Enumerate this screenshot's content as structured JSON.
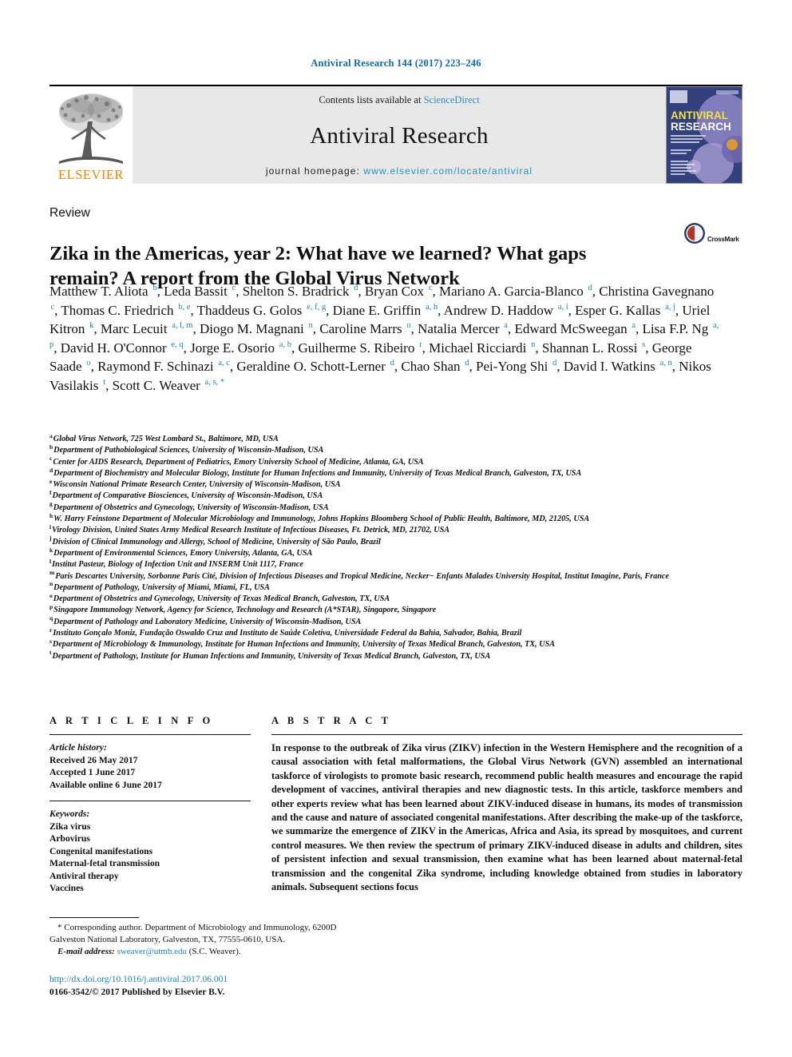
{
  "running_head": "Antiviral Research 144 (2017) 223–246",
  "masthead": {
    "publisher_name": "ELSEVIER",
    "contents_prefix": "Contents lists available at",
    "contents_link": "ScienceDirect",
    "journal_title": "Antiviral Research",
    "homepage_prefix": "journal homepage:",
    "homepage_url": "www.elsevier.com/locate/antiviral",
    "cover_title_line1": "ANTIVIRAL",
    "cover_title_line2": "RESEARCH"
  },
  "article_type": "Review",
  "title": "Zika in the Americas, year 2: What have we learned? What gaps remain? A report from the Global Virus Network",
  "crossmark": {
    "label": "CrossMark"
  },
  "authors_html": "Matthew T. Aliota <sup>b</sup>, Leda Bassit <sup>c</sup>, Shelton S. Bradrick <sup>d</sup>, Bryan Cox <sup>c</sup>, Mariano A. Garcia-Blanco <sup>d</sup>, Christina Gavegnano <sup>c</sup>, Thomas C. Friedrich <sup>b, e</sup>, Thaddeus G. Golos <sup>e, f, g</sup>, Diane E. Griffin <sup>a, h</sup>, Andrew D. Haddow <sup>a, i</sup>, Esper G. Kallas <sup>a, j</sup>, Uriel Kitron <sup>k</sup>, Marc Lecuit <sup>a, l, m</sup>, Diogo M. Magnani <sup>n</sup>, Caroline Marrs <sup>o</sup>, Natalia Mercer <sup>a</sup>, Edward McSweegan <sup>a</sup>, Lisa F.P. Ng <sup>a, p</sup>, David H. O'Connor <sup>e, q</sup>, Jorge E. Osorio <sup>a, b</sup>, Guilherme S. Ribeiro <sup>r</sup>, Michael Ricciardi <sup>n</sup>, Shannan L. Rossi <sup>s</sup>, George Saade <sup>o</sup>, Raymond F. Schinazi <sup>a, c</sup>, Geraldine O. Schott-Lerner <sup>d</sup>, Chao Shan <sup>d</sup>, Pei-Yong Shi <sup>d</sup>, David I. Watkins <sup>a, n</sup>, Nikos Vasilakis <sup>t</sup>, Scott C. Weaver <sup>a, s, *</sup>",
  "affiliations": [
    {
      "marker": "a",
      "text": "Global Virus Network, 725 West Lombard St., Baltimore, MD, USA"
    },
    {
      "marker": "b",
      "text": "Department of Pathobiological Sciences, University of Wisconsin-Madison, USA"
    },
    {
      "marker": "c",
      "text": "Center for AIDS Research, Department of Pediatrics, Emory University School of Medicine, Atlanta, GA, USA"
    },
    {
      "marker": "d",
      "text": "Department of Biochemistry and Molecular Biology, Institute for Human Infections and Immunity, University of Texas Medical Branch, Galveston, TX, USA"
    },
    {
      "marker": "e",
      "text": "Wisconsin National Primate Research Center, University of Wisconsin-Madison, USA"
    },
    {
      "marker": "f",
      "text": "Department of Comparative Biosciences, University of Wisconsin-Madison, USA"
    },
    {
      "marker": "g",
      "text": "Department of Obstetrics and Gynecology, University of Wisconsin-Madison, USA"
    },
    {
      "marker": "h",
      "text": "W. Harry Feinstone Department of Molecular Microbiology and Immunology, Johns Hopkins Bloomberg School of Public Health, Baltimore, MD, 21205, USA"
    },
    {
      "marker": "i",
      "text": "Virology Division, United States Army Medical Research Institute of Infectious Diseases, Ft. Detrick, MD, 21702, USA"
    },
    {
      "marker": "j",
      "text": "Division of Clinical Immunology and Allergy, School of Medicine, University of São Paulo, Brazil"
    },
    {
      "marker": "k",
      "text": "Department of Environmental Sciences, Emory University, Atlanta, GA, USA"
    },
    {
      "marker": "l",
      "text": "Institut Pasteur, Biology of Infection Unit and INSERM Unit 1117, France"
    },
    {
      "marker": "m",
      "text": "Paris Descartes University, Sorbonne Paris Cité, Division of Infectious Diseases and Tropical Medicine, Necker− Enfants Malades University Hospital, Institut Imagine, Paris, France"
    },
    {
      "marker": "n",
      "text": "Department of Pathology, University of Miami, Miami, FL, USA"
    },
    {
      "marker": "o",
      "text": "Department of Obstetrics and Gynecology, University of Texas Medical Branch, Galveston, TX, USA"
    },
    {
      "marker": "p",
      "text": "Singapore Immunology Network, Agency for Science, Technology and Research (A*STAR), Singapore, Singapore"
    },
    {
      "marker": "q",
      "text": "Department of Pathology and Laboratory Medicine, University of Wisconsin-Madison, USA"
    },
    {
      "marker": "r",
      "text": "Instituto Gonçalo Moniz, Fundação Oswaldo Cruz and Instituto de Saúde Coletiva, Universidade Federal da Bahia, Salvador, Bahia, Brazil"
    },
    {
      "marker": "s",
      "text": "Department of Microbiology & Immunology, Institute for Human Infections and Immunity, University of Texas Medical Branch, Galveston, TX, USA"
    },
    {
      "marker": "t",
      "text": "Department of Pathology, Institute for Human Infections and Immunity, University of Texas Medical Branch, Galveston, TX, USA"
    }
  ],
  "article_info": {
    "heading": "A R T I C L E   I N F O",
    "history_label": "Article history:",
    "history": [
      "Received 26 May 2017",
      "Accepted 1 June 2017",
      "Available online 6 June 2017"
    ],
    "keywords_label": "Keywords:",
    "keywords": [
      "Zika virus",
      "Arbovirus",
      "Congenital manifestations",
      "Maternal-fetal transmission",
      "Antiviral therapy",
      "Vaccines"
    ]
  },
  "abstract": {
    "heading": "A B S T R A C T",
    "text": "In response to the outbreak of Zika virus (ZIKV) infection in the Western Hemisphere and the recognition of a causal association with fetal malformations, the Global Virus Network (GVN) assembled an international taskforce of virologists to promote basic research, recommend public health measures and encourage the rapid development of vaccines, antiviral therapies and new diagnostic tests. In this article, taskforce members and other experts review what has been learned about ZIKV-induced disease in humans, its modes of transmission and the cause and nature of associated congenital manifestations. After describing the make-up of the taskforce, we summarize the emergence of ZIKV in the Americas, Africa and Asia, its spread by mosquitoes, and current control measures. We then review the spectrum of primary ZIKV-induced disease in adults and children, sites of persistent infection and sexual transmission, then examine what has been learned about maternal-fetal transmission and the congenital Zika syndrome, including knowledge obtained from studies in laboratory animals. Subsequent sections focus"
  },
  "footnote": {
    "line1": "* Corresponding author. Department of Microbiology and Immunology, 6200D",
    "line2": "Galveston National Laboratory, Galveston, TX, 77555-0610, USA.",
    "email_label": "E-mail address:",
    "email": "sweaver@utmb.edu",
    "email_suffix": "(S.C. Weaver)."
  },
  "doi": {
    "url": "http://dx.doi.org/10.1016/j.antiviral.2017.06.001",
    "copyright": "0166-3542/© 2017 Published by Elsevier B.V."
  }
}
